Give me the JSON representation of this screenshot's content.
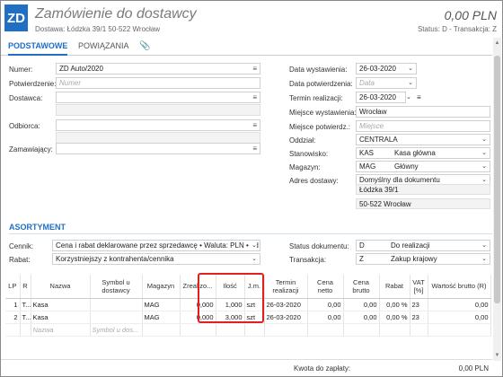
{
  "header": {
    "logo": "ZD",
    "title": "Zamówienie do dostawcy",
    "subtitle": "Dostawa: Łódzka 39/1 50-522 Wrocław",
    "amount": "0,00 PLN",
    "status_line": "Status: D - Transakcja: Z"
  },
  "tabs": [
    {
      "label": "PODSTAWOWE",
      "active": true
    },
    {
      "label": "POWIĄZANIA",
      "active": false
    }
  ],
  "left_form": {
    "numer_label": "Numer:",
    "numer_value": "ZD Auto/2020",
    "potwierdzenie_label": "Potwierdzenie:",
    "potwierdzenie_placeholder": "Numer",
    "dostawca_label": "Dostawca:",
    "odbiorca_label": "Odbiorca:",
    "zamawiajacy_label": "Zamawiający:"
  },
  "right_form": {
    "data_wystawienia_label": "Data wystawienia:",
    "data_wystawienia_value": "26-03-2020",
    "data_potwierdzenia_label": "Data potwierdzenia:",
    "data_potwierdzenia_placeholder": "Data",
    "termin_realizacji_label": "Termin realizacji:",
    "termin_realizacji_value": "26-03-2020",
    "miejsce_wystawienia_label": "Miejsce wystawienia:",
    "miejsce_wystawienia_value": "Wrocław",
    "miejsce_potwierdz_label": "Miejsce potwierdz.:",
    "miejsce_potwierdz_placeholder": "Miejsce",
    "oddzial_label": "Oddział:",
    "oddzial_value": "CENTRALA",
    "stanowisko_label": "Stanowisko:",
    "stanowisko_code": "KAS",
    "stanowisko_value": "Kasa główna",
    "magazyn_label": "Magazyn:",
    "magazyn_code": "MAG",
    "magazyn_value": "Główny",
    "adres_dostawy_label": "Adres dostawy:",
    "adres_dostawy_value": "Domyślny dla dokumentu",
    "adres_line1": "Łódzka 39/1",
    "adres_line2": "50-522 Wrocław"
  },
  "asortyment": {
    "section_title": "ASORTYMENT",
    "cennik_label": "Cennik:",
    "cennik_value": "Cena i rabat deklarowane przez sprzedawcę • Waluta: PLN • od bru",
    "rabat_label": "Rabat:",
    "rabat_value": "Korzystniejszy z kontrahenta/cennika",
    "status_dokumentu_label": "Status dokumentu:",
    "status_code": "D",
    "status_value": "Do realizacji",
    "transakcja_label": "Transakcja:",
    "transakcja_code": "Z",
    "transakcja_value": "Zakup krajowy"
  },
  "grid": {
    "headers": [
      "LP",
      "R",
      "Nazwa",
      "Symbol u dostawcy",
      "Magazyn",
      "Zrealizo...",
      "Ilość",
      "J.m.",
      "Termin realizacji",
      "Cena netto",
      "Cena brutto",
      "Rabat",
      "VAT [%]",
      "Wartość brutto (R)"
    ],
    "rows": [
      [
        "1",
        "T...",
        "Kasa",
        "",
        "MAG",
        "0,000",
        "1,000",
        "szt",
        "26-03-2020",
        "0,00",
        "0,00",
        "0,00 %",
        "23",
        "0,00"
      ],
      [
        "2",
        "T...",
        "Kasa",
        "",
        "MAG",
        "0,000",
        "3,000",
        "szt",
        "26-03-2020",
        "0,00",
        "0,00",
        "0,00 %",
        "23",
        "0,00"
      ]
    ],
    "new_row": {
      "nazwa_placeholder": "Nazwa",
      "symbol_placeholder": "Symbol u dos..."
    }
  },
  "footer": {
    "kwota_label": "Kwota do zapłaty:",
    "kwota_value": "0,00 PLN"
  },
  "colors": {
    "accent": "#1f6fc5",
    "highlight": "#e02020"
  }
}
